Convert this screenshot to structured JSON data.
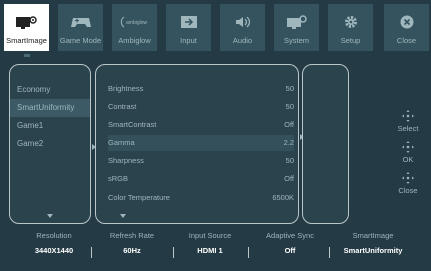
{
  "tabs": [
    {
      "label": "SmartImage",
      "icon": "smartimage-icon"
    },
    {
      "label": "Game Mode",
      "icon": "gamepad-icon"
    },
    {
      "label": "Ambiglow",
      "icon": "ambiglow-icon"
    },
    {
      "label": "Input",
      "icon": "input-icon"
    },
    {
      "label": "Audio",
      "icon": "speaker-icon"
    },
    {
      "label": "System",
      "icon": "system-icon"
    },
    {
      "label": "Setup",
      "icon": "gear-icon"
    },
    {
      "label": "Close",
      "icon": "close-icon"
    }
  ],
  "ambiglow_logo_text": "ambiglow",
  "modes": [
    "Economy",
    "SmartUniformity",
    "Game1",
    "Game2"
  ],
  "settings": [
    {
      "label": "Brightness",
      "value": "50"
    },
    {
      "label": "Contrast",
      "value": "50"
    },
    {
      "label": "SmartContrast",
      "value": "Off"
    },
    {
      "label": "Gamma",
      "value": "2.2"
    },
    {
      "label": "Sharpness",
      "value": "50"
    },
    {
      "label": "sRGB",
      "value": "Off"
    },
    {
      "label": "Color Temperature",
      "value": "6500K"
    }
  ],
  "controls": [
    {
      "label": "Select",
      "icon": "joystick-select-icon"
    },
    {
      "label": "OK",
      "icon": "joystick-ok-icon"
    },
    {
      "label": "Close",
      "icon": "joystick-close-icon"
    }
  ],
  "status": [
    {
      "label": "Resolution",
      "value": "3440X1440"
    },
    {
      "label": "Refresh Rate",
      "value": "60Hz"
    },
    {
      "label": "Input Source",
      "value": "HDMI 1"
    },
    {
      "label": "Adaptive Sync",
      "value": "Off"
    },
    {
      "label": "SmartImage",
      "value": "SmartUniformity"
    }
  ],
  "colors": {
    "background": "#243a44",
    "tab": "#35535e",
    "active_tab": "#ffffff",
    "text": "#9fb6bd"
  }
}
